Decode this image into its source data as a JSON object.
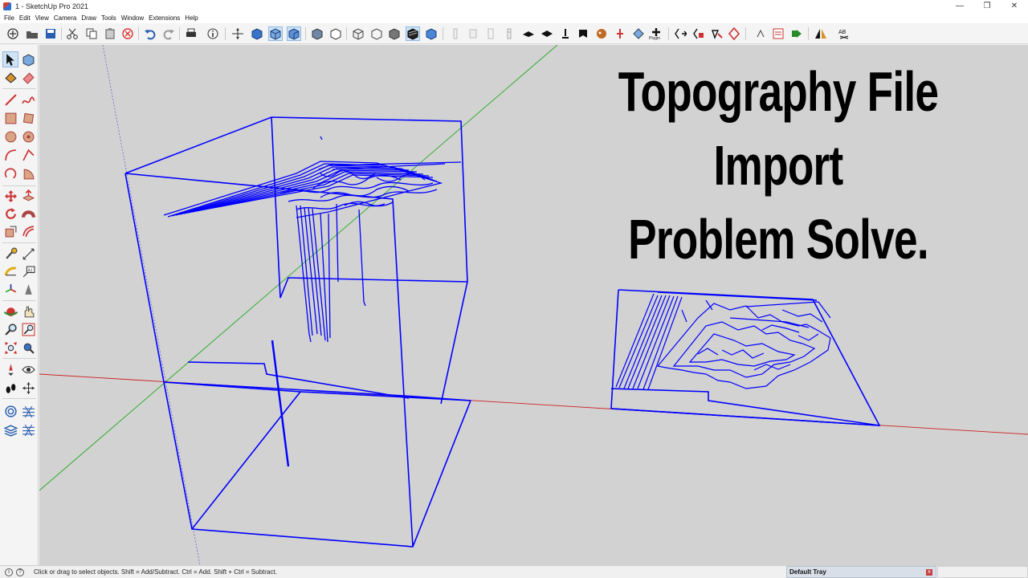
{
  "window": {
    "title": "1 - SketchUp Pro 2021",
    "controls": {
      "minimize": "—",
      "restore": "❐",
      "close": "✕"
    }
  },
  "menu": [
    "File",
    "Edit",
    "View",
    "Camera",
    "Draw",
    "Tools",
    "Window",
    "Extensions",
    "Help"
  ],
  "toolbar": {
    "plugin_label": "Plugin",
    "icons": [
      "new-icon",
      "open-icon",
      "save-icon",
      "cut-icon",
      "copy-icon",
      "paste-icon",
      "erase-icon",
      "undo-icon",
      "redo-icon",
      "print-icon",
      "model-info-icon",
      "iso-view-icon",
      "top-view-icon",
      "front-view-icon",
      "right-view-icon",
      "back-view-icon",
      "left-view-icon",
      "xray-icon",
      "back-edges-icon",
      "wireframe-icon",
      "hidden-line-icon",
      "shaded-icon",
      "shaded-textures-icon",
      "monochrome-icon",
      "warehouse-icon",
      "extension-icon",
      "sandbox-icon",
      "section-icon",
      "plugin-icon",
      "advanced-icon",
      "flip-icon",
      "text-icon"
    ]
  },
  "viewport": {
    "headline": [
      "Topography File",
      "Import",
      "Problem Solve."
    ],
    "colors": {
      "background": "#d2d2d2",
      "geometry": "#0000ff",
      "axis_red": "#cc2222",
      "axis_green": "#22aa22",
      "axis_blue": "#2222cc",
      "headline": "#000000"
    }
  },
  "statusbar": {
    "hint": "Click or drag to select objects. Shift = Add/Subtract. Ctrl = Add. Shift + Ctrl = Subtract.",
    "tray_label": "Default Tray",
    "tray_close": "x"
  }
}
